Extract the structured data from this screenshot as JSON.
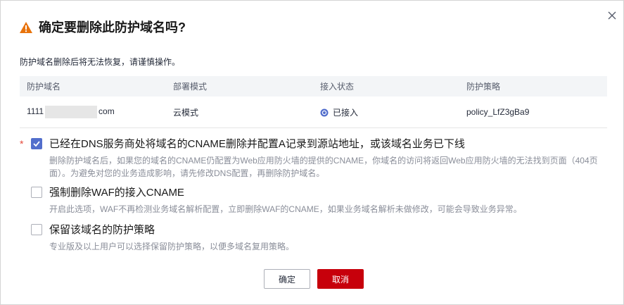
{
  "dialog": {
    "title": "确定要删除此防护域名吗?",
    "description": "防护域名删除后将无法恢复，请谨慎操作。",
    "warning_color": "#e8730c",
    "accent_color": "#526ecc",
    "danger_color": "#c7000b"
  },
  "table": {
    "headers": [
      "防护域名",
      "部署模式",
      "接入状态",
      "防护策略"
    ],
    "rows": [
      {
        "domain_prefix": "1111",
        "domain_suffix": "com",
        "mode": "云模式",
        "status": "已接入",
        "policy": "policy_LfZ3gBa9"
      }
    ]
  },
  "options": [
    {
      "required_mark": "*",
      "checked": true,
      "label": "已经在DNS服务商处将域名的CNAME删除并配置A记录到源站地址，或该域名业务已下线",
      "hint": "删除防护域名后，如果您的域名的CNAME仍配置为Web应用防火墙的提供的CNAME，你域名的访问将返回Web应用防火墙的无法找到页面（404页面）。为避免对您的业务造成影响，请先修改DNS配置，再删除防护域名。"
    },
    {
      "checked": false,
      "label": "强制删除WAF的接入CNAME",
      "hint": "开启此选项，WAF不再检测业务域名解析配置，立即删除WAF的CNAME，如果业务域名解析未做修改，可能会导致业务异常。"
    },
    {
      "checked": false,
      "label": "保留该域名的防护策略",
      "hint": "专业版及以上用户可以选择保留防护策略，以便多域名复用策略。"
    }
  ],
  "buttons": {
    "ok": "确定",
    "cancel": "取消"
  }
}
